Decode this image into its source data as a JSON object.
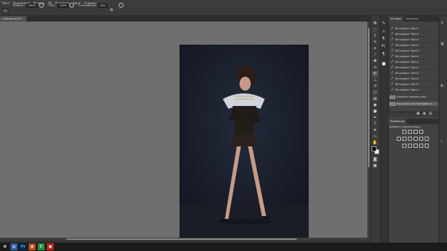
{
  "menu": [
    "Текст",
    "Выделение",
    "Фильтр",
    "3D",
    "Просмотр",
    "Окно",
    "Справка"
  ],
  "options": {
    "opacity_label": "Непрозр.:",
    "opacity_value": "100%",
    "pressure_label": "Наж.:",
    "pressure_value": "100%",
    "smoothing_label": "Сглаживание:",
    "smoothing_value": "10%"
  },
  "document_tab": "Слой-маска/16 *",
  "panels": {
    "history_tab": "История",
    "actions_tab": "Операции",
    "history_items": [
      "Инструмент \"Кисть\"",
      "Инструмент \"Кисть\"",
      "Инструмент \"Кисть\"",
      "Инструмент \"Кисть\"",
      "Инструмент \"Кисть\"",
      "Инструмент \"Кисть\"",
      "Инструмент \"Кисть\"",
      "Инструмент \"Кисть\"",
      "Инструмент \"Кисть\"",
      "Инструмент \"Кисть\"",
      "Инструмент \"Кисть\"",
      "Инструмент \"Кисть\"",
      "Изменить параметр слоя",
      "Настройка слоя \"Цветовой то..."
    ],
    "adjustments_tab": "Коррекция",
    "adjustments_add": "Добавить корректировку"
  },
  "colors": {
    "foreground": "#000000",
    "background": "#ffffff",
    "canvas_bg": "#6f6f6f"
  },
  "dock_apps": [
    "windows-icon",
    "file-explorer-icon",
    "photoshop-icon",
    "browser-icon",
    "camtasia-icon",
    "recorder-icon"
  ]
}
